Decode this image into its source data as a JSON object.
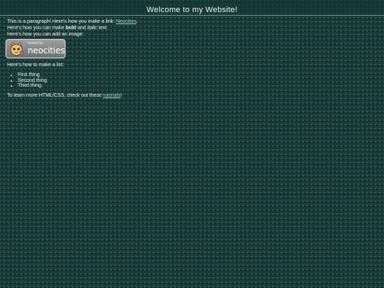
{
  "page": {
    "title": "Welcome to my Website!"
  },
  "intro": {
    "text": "This is a paragraph! Here's how you make a link: ",
    "link_label": "Neocities",
    "link_suffix": "."
  },
  "formatting": {
    "prefix": "Here's how you can make ",
    "bold_word": "bold",
    "middle": " and ",
    "italic_word": "italic",
    "suffix": " text."
  },
  "image_line": {
    "text": "Here's how you can add an image:"
  },
  "badge": {
    "small_text": "hosted by",
    "big_text": "neocities"
  },
  "list": {
    "intro": "Here's how to make a list:",
    "items": [
      "First thing",
      "Second thing",
      "Third thing"
    ]
  },
  "outro": {
    "text": "To learn more HTML/CSS, check out these ",
    "link_label": "tutorials",
    "suffix": "!"
  },
  "colors": {
    "background": "#1a3a37",
    "text": "#f2f6f3",
    "link": "#9fd3c6"
  }
}
